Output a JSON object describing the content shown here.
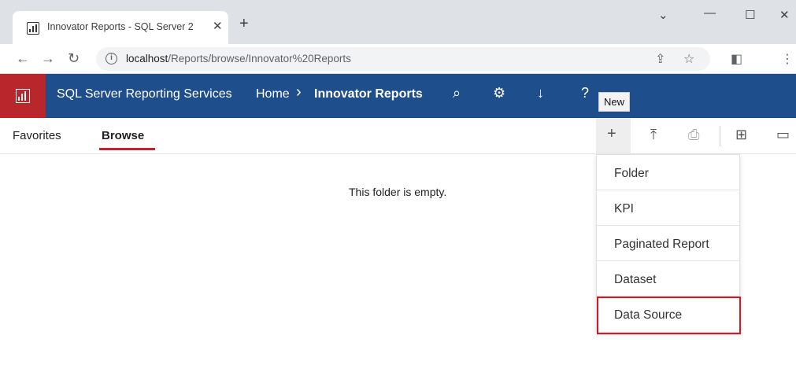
{
  "browser": {
    "tab_title": "Innovator Reports - SQL Server 2",
    "tab_close": "✕",
    "new_tab": "+",
    "url_host": "localhost",
    "url_path": "/Reports/browse/Innovator%20Reports"
  },
  "ssrs": {
    "title": "SQL Server Reporting Services",
    "breadcrumb": {
      "home": "Home",
      "separator": "›",
      "current": "Innovator Reports"
    },
    "tooltip": "New",
    "accent_color": "#b9262b",
    "header_color": "#1f4e8c"
  },
  "nav": {
    "favorites": "Favorites",
    "browse": "Browse"
  },
  "main": {
    "empty_message": "This folder is empty."
  },
  "new_menu": {
    "items": [
      "Folder",
      "KPI",
      "Paginated Report",
      "Dataset",
      "Data Source"
    ],
    "highlighted": "Data Source"
  }
}
